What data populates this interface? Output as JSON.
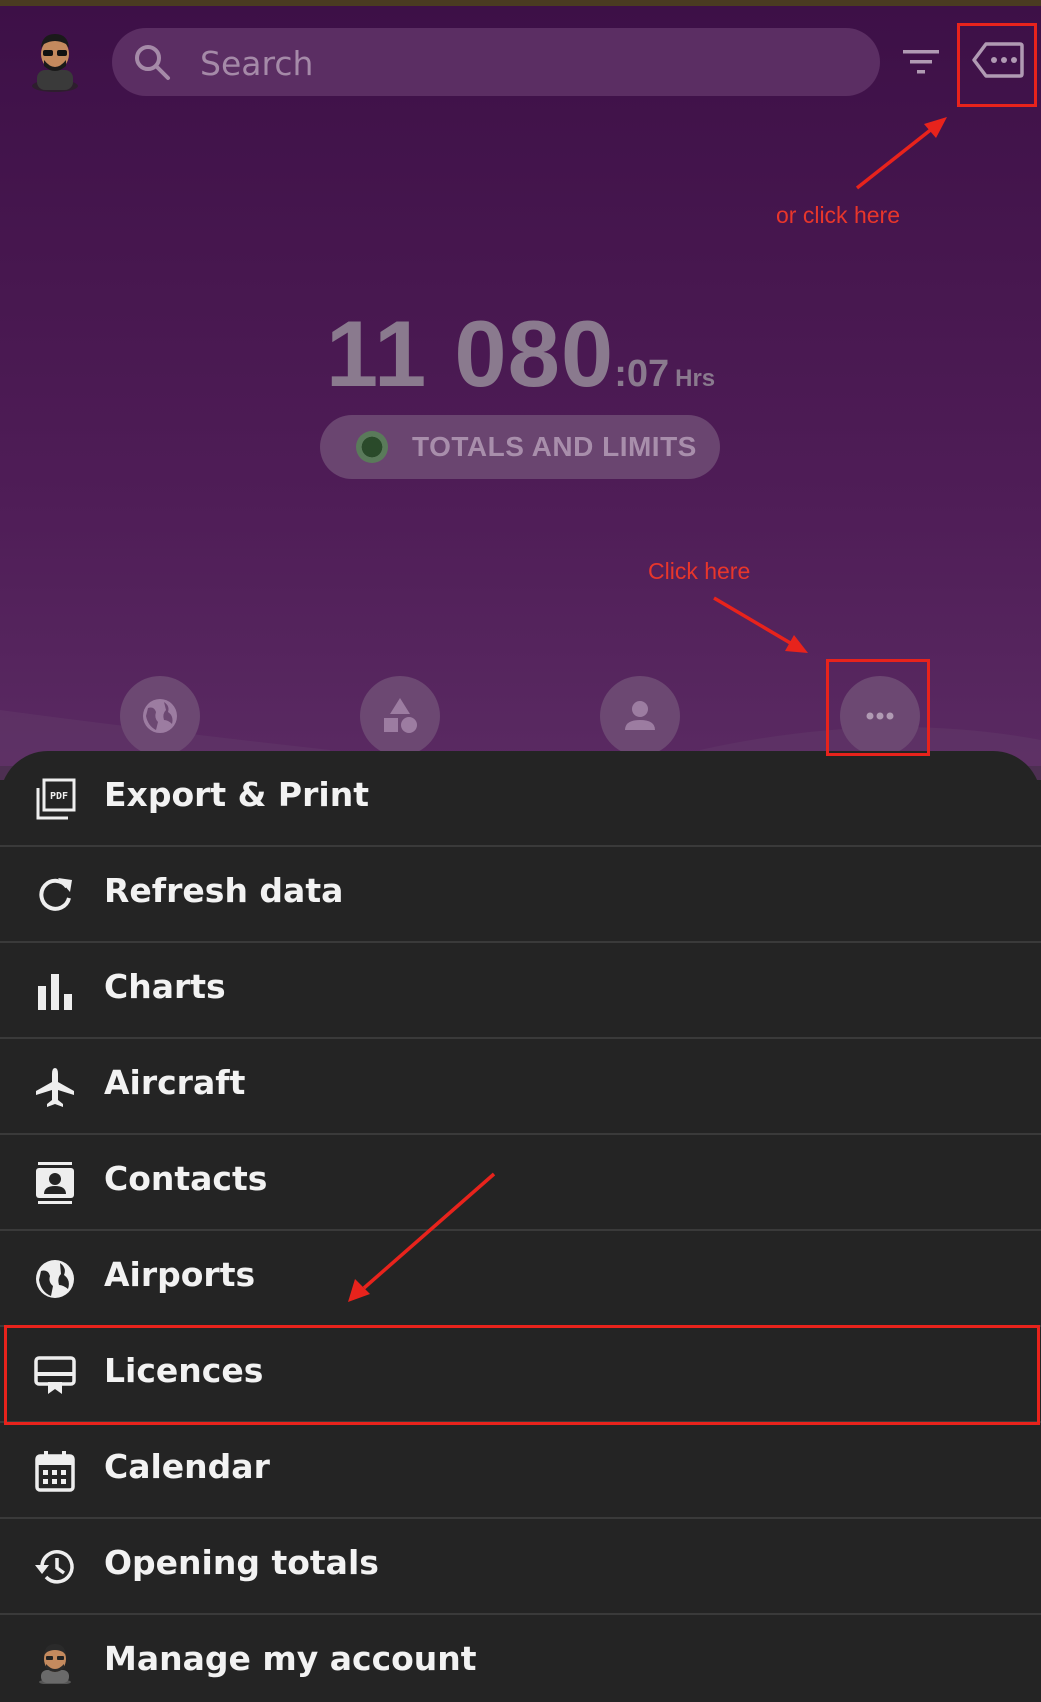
{
  "header": {
    "search_placeholder": "Search",
    "total_main": "11 080",
    "total_minutes": ":07",
    "total_unit": "Hrs",
    "totals_button_label": "TOTALS AND LIMITS"
  },
  "annotations": {
    "click_here": "Click here",
    "or_click_here": "or click here",
    "highlight_color": "#e8231c"
  },
  "nav": [
    "globe-icon",
    "shapes-icon",
    "person-icon",
    "more-icon"
  ],
  "menu": {
    "items": [
      {
        "label": "Export & Print",
        "icon": "pdf-icon"
      },
      {
        "label": "Refresh data",
        "icon": "refresh-icon"
      },
      {
        "label": "Charts",
        "icon": "bar-chart-icon"
      },
      {
        "label": "Aircraft",
        "icon": "airplane-icon"
      },
      {
        "label": "Contacts",
        "icon": "contacts-icon"
      },
      {
        "label": "Airports",
        "icon": "globe-icon"
      },
      {
        "label": "Licences",
        "icon": "licence-icon"
      },
      {
        "label": "Calendar",
        "icon": "calendar-icon"
      },
      {
        "label": "Opening totals",
        "icon": "history-icon"
      },
      {
        "label": "Manage my account",
        "icon": "avatar-icon"
      }
    ]
  },
  "colors": {
    "header_purple": "#47174f",
    "sheet_dark": "#242424",
    "annotation_red": "#e8362b"
  }
}
